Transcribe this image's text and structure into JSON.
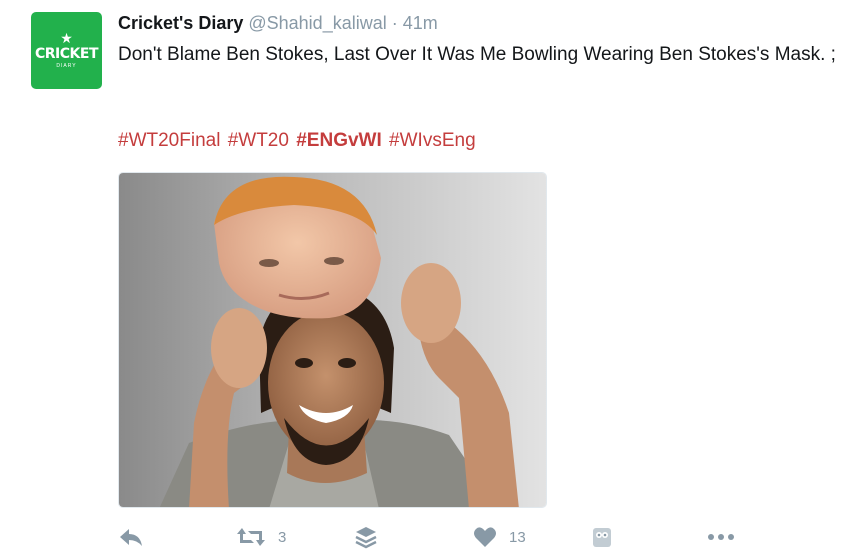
{
  "tweet": {
    "author": {
      "name": "Cricket's Diary",
      "handle": "@Shahid_kaliwal",
      "separator": "·",
      "time": "41m",
      "avatar": {
        "brand": "CRICKET",
        "sub": "DIARY",
        "color": "#22b14c",
        "icon": "star-icon"
      }
    },
    "text": "Don't Blame Ben Stokes, Last Over It Was Me Bowling Wearing Ben Stokes's Mask. ;",
    "hashtags": [
      {
        "label": "#WT20Final",
        "bold": false
      },
      {
        "label": "#WT20",
        "bold": false
      },
      {
        "label": "#ENGvWI",
        "bold": true
      },
      {
        "label": "#WIvsEng",
        "bold": false
      }
    ],
    "media": {
      "kind": "photo-meme"
    },
    "actions": {
      "reply": {
        "icon": "reply-icon"
      },
      "retweet": {
        "icon": "retweet-icon",
        "count": "3"
      },
      "buffer": {
        "icon": "buffer-icon"
      },
      "like": {
        "icon": "heart-icon",
        "count": "13"
      },
      "hootsuite": {
        "icon": "owl-icon"
      },
      "more": {
        "icon": "more-dots-icon"
      }
    },
    "colors": {
      "hashtag": "#c43d3d",
      "meta": "#8899a6",
      "text": "#14171a"
    }
  }
}
